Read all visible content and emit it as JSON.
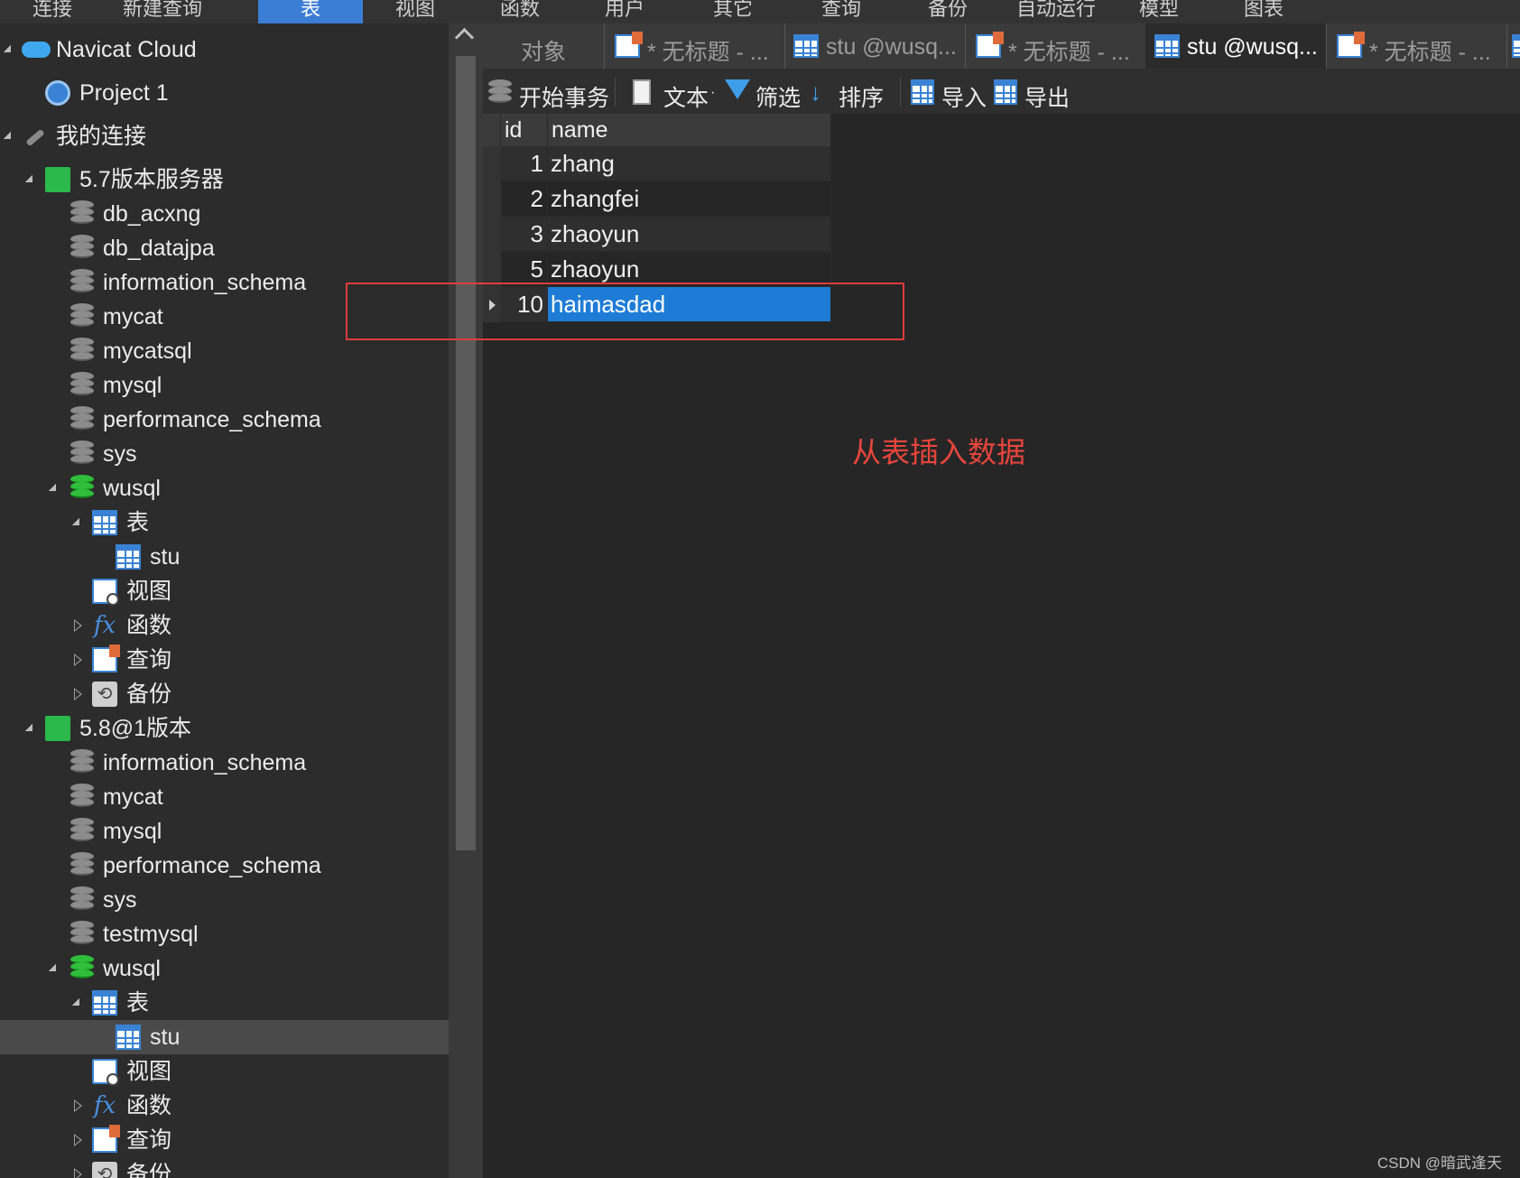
{
  "menu": {
    "items": [
      "连接",
      "新建查询",
      "表",
      "视图",
      "函数",
      "用户",
      "其它",
      "查询",
      "备份",
      "自动运行",
      "模型",
      "图表"
    ],
    "active": "表"
  },
  "sidebar": {
    "cloud": "Navicat Cloud",
    "project": "Project 1",
    "my_connections": "我的连接",
    "server1": {
      "name": "5.7版本服务器",
      "databases": [
        "db_acxng",
        "db_datajpa",
        "information_schema",
        "mycat",
        "mycatsql",
        "mysql",
        "performance_schema",
        "sys"
      ],
      "open_db": "wusql",
      "tables_label": "表",
      "table": "stu",
      "views_label": "视图",
      "functions_label": "函数",
      "queries_label": "查询",
      "backups_label": "备份"
    },
    "server2": {
      "name": "5.8@1版本",
      "databases": [
        "information_schema",
        "mycat",
        "mysql",
        "performance_schema",
        "sys",
        "testmysql"
      ],
      "open_db": "wusql",
      "tables_label": "表",
      "table": "stu",
      "views_label": "视图",
      "functions_label": "函数",
      "queries_label": "查询",
      "backups_label": "备份"
    }
  },
  "tabs": [
    {
      "label": "对象"
    },
    {
      "label": "* 无标题 - ..."
    },
    {
      "label": "stu @wusq..."
    },
    {
      "label": "* 无标题 - ..."
    },
    {
      "label": "stu @wusq...",
      "active": true
    },
    {
      "label": "* 无标题 - ..."
    }
  ],
  "toolbar": {
    "begin_transaction": "开始事务",
    "text": "文本",
    "filter": "筛选",
    "sort": "排序",
    "import": "导入",
    "export": "导出"
  },
  "grid": {
    "columns": [
      "id",
      "name"
    ],
    "rows": [
      {
        "id": "1",
        "name": "zhang"
      },
      {
        "id": "2",
        "name": "zhangfei"
      },
      {
        "id": "3",
        "name": "zhaoyun"
      },
      {
        "id": "5",
        "name": "zhaoyun"
      },
      {
        "id": "10",
        "name": "haimasdad",
        "selected": true
      }
    ]
  },
  "annotation": "从表插入数据",
  "watermark": "CSDN @暗武逢天",
  "colors": {
    "accent": "#3b7ed6",
    "selection": "#1e7cd6",
    "annotation_red": "#e03c3c",
    "background": "#2b2b2b"
  }
}
